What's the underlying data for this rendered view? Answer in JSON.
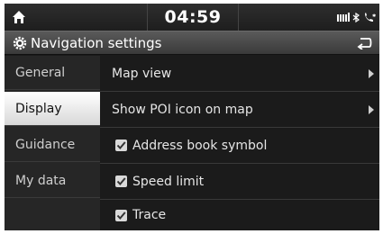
{
  "status_bar": {
    "home_icon": "home-icon",
    "time": "04:59",
    "status_icons": [
      "signal-bars-icon",
      "bluetooth-icon",
      "phone-icon"
    ]
  },
  "title_bar": {
    "icon": "gear-icon",
    "title": "Navigation settings",
    "back_icon": "back-arrow-icon"
  },
  "sidebar": {
    "items": [
      {
        "label": "General",
        "active": false
      },
      {
        "label": "Display",
        "active": true
      },
      {
        "label": "Guidance",
        "active": false
      },
      {
        "label": "My data",
        "active": false
      }
    ]
  },
  "settings": {
    "rows": [
      {
        "label": "Map view",
        "type": "submenu"
      },
      {
        "label": "Show POI icon on map",
        "type": "submenu"
      },
      {
        "label": "Address book symbol",
        "type": "checkbox",
        "checked": true
      },
      {
        "label": "Speed limit",
        "type": "checkbox",
        "checked": true
      },
      {
        "label": "Trace",
        "type": "checkbox",
        "checked": true
      }
    ]
  },
  "colors": {
    "background": "#1b1b1b",
    "active_tab": "#ffffff",
    "text": "#e6e6e6"
  }
}
